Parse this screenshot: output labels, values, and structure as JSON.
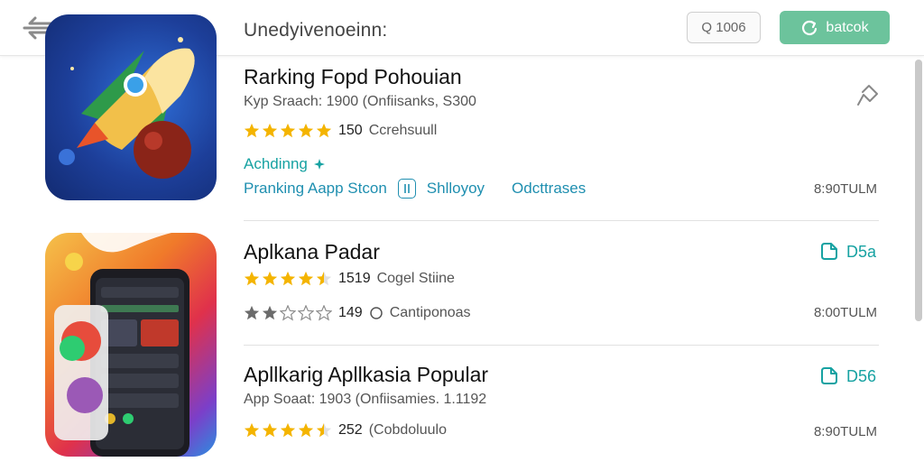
{
  "header": {
    "title": "Unedyivenoeinn:",
    "search_label": "Q 1006",
    "action_label": "batcok"
  },
  "apps": [
    {
      "name": "Rarking Fopd Pohouian",
      "sub": "Kyp Sraach: 1900  (Onfiisanks,  S300",
      "stars_filled": 5,
      "rating_count": "150",
      "rating_label": "Ccrehsuull",
      "status": "Achdinng",
      "links": [
        "Pranking Aapp Stcon",
        "Shlloyoy",
        "Odcttrases"
      ],
      "time": "8:90TULM",
      "icon": "rocket-icon"
    },
    {
      "name": "Aplkana Padar",
      "stars_filled": 4.5,
      "rating_count": "1519",
      "rating_label": "Cogel Stiine",
      "stars2_filled": 2.5,
      "rating2_count": "149",
      "rating2_label": "Cantiponoas",
      "price": "D5a",
      "time": "8:00TULM",
      "icon": "phone-icon"
    },
    {
      "name": "Apllkarig Apllkasia Popular",
      "sub": "App Soaat: 1903  (Onfiisamies. 1.1192",
      "stars_filled": 4.5,
      "rating_count": "252",
      "rating_label": "(Cobdoluulo",
      "price": "D56",
      "time": "8:90TULM"
    }
  ],
  "colors": {
    "accent": "#6cc39c",
    "teal": "#17a2a2",
    "link": "#1f8fb0",
    "star": "#f4b400"
  }
}
